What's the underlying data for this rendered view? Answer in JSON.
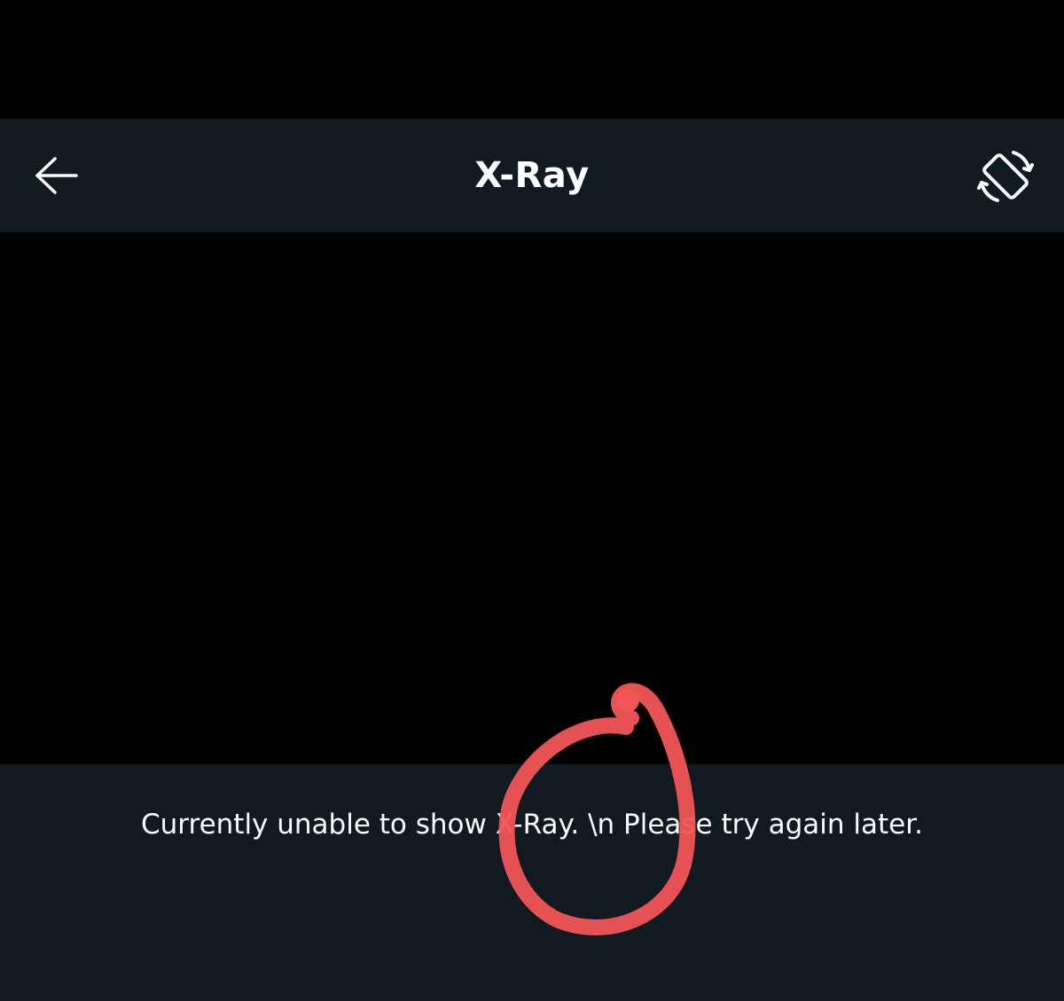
{
  "header": {
    "title": "X-Ray",
    "back_icon": "arrow-left-icon",
    "rotate_icon": "screen-rotation-icon"
  },
  "message": {
    "text": "Currently unable to show X-Ray. \\n Please try again later."
  },
  "annotation": {
    "shape": "hand-drawn-circle",
    "color": "#f25557"
  },
  "colors": {
    "bar_background": "#111921",
    "page_background": "#000000",
    "text": "#ffffff"
  }
}
